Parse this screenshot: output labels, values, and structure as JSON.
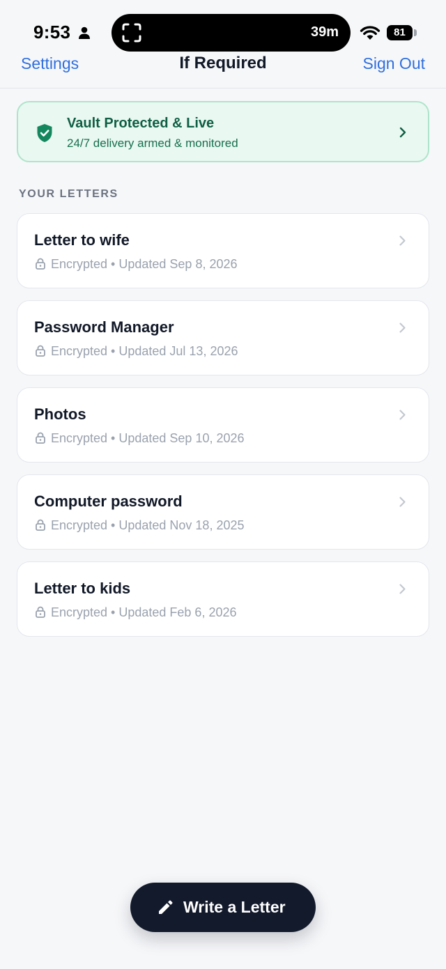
{
  "status_bar": {
    "time": "9:53",
    "island_timer": "39m",
    "battery": "81",
    "icons": [
      "person-icon",
      "screen-record-icon",
      "wifi-icon",
      "battery-icon"
    ]
  },
  "nav": {
    "left": "Settings",
    "title": "If Required",
    "right": "Sign Out"
  },
  "vault": {
    "title": "Vault Protected & Live",
    "subtitle": "24/7 delivery armed & monitored",
    "icon": "shield-check-icon"
  },
  "section_label": "YOUR LETTERS",
  "letters": [
    {
      "title": "Letter to wife",
      "status": "Encrypted",
      "separator": "•",
      "updated": "Updated Sep 8, 2026"
    },
    {
      "title": "Password Manager",
      "status": "Encrypted",
      "separator": "•",
      "updated": "Updated Jul 13, 2026"
    },
    {
      "title": "Photos",
      "status": "Encrypted",
      "separator": "•",
      "updated": "Updated Sep 10, 2026"
    },
    {
      "title": "Computer password",
      "status": "Encrypted",
      "separator": "•",
      "updated": "Updated Nov 18, 2025"
    },
    {
      "title": "Letter to kids",
      "status": "Encrypted",
      "separator": "•",
      "updated": "Updated Feb 6, 2026"
    }
  ],
  "write_button": {
    "label": "Write a Letter",
    "icon": "pencil-icon"
  },
  "colors": {
    "accent": "#2f6fde",
    "background": "#f6f7f9",
    "vault_bg": "#e9f8f1",
    "vault_border": "#aee4cb",
    "vault_text": "#0f5f44",
    "button_bg": "#131a2c"
  }
}
